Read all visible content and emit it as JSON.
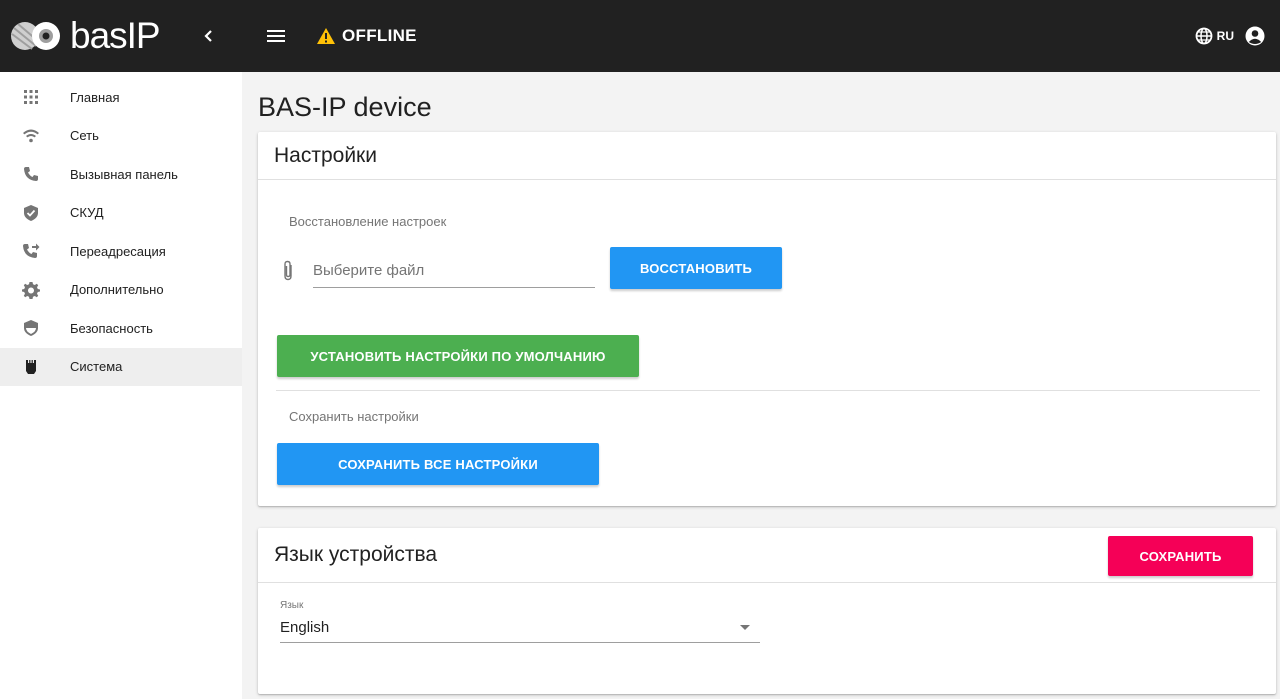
{
  "brand": {
    "name": "basIP"
  },
  "sidebar": {
    "items": [
      {
        "label": "Главная",
        "icon": "apps-grid-icon",
        "active": false
      },
      {
        "label": "Сеть",
        "icon": "wifi-icon",
        "active": false
      },
      {
        "label": "Вызывная панель",
        "icon": "phone-icon",
        "active": false
      },
      {
        "label": "СКУД",
        "icon": "shield-check-icon",
        "active": false
      },
      {
        "label": "Переадресация",
        "icon": "phone-forward-icon",
        "active": false
      },
      {
        "label": "Дополнительно",
        "icon": "gear-icon",
        "active": false
      },
      {
        "label": "Безопасность",
        "icon": "security-shield-icon",
        "active": false
      },
      {
        "label": "Система",
        "icon": "memory-card-icon",
        "active": true
      }
    ]
  },
  "topbar": {
    "status": "OFFLINE",
    "status_color": "#ffc107",
    "language": "RU"
  },
  "page": {
    "title": "BAS-IP device"
  },
  "settings_card": {
    "title": "Настройки",
    "restore_label": "Восстановление настроек",
    "file_placeholder": "Выберите файл",
    "restore_button": "ВОССТАНОВИТЬ",
    "defaults_button": "УСТАНОВИТЬ НАСТРОЙКИ ПО УМОЛЧАНИЮ",
    "save_label": "Сохранить настройки",
    "save_all_button": "СОХРАНИТЬ ВСЕ НАСТРОЙКИ"
  },
  "language_card": {
    "title": "Язык устройства",
    "save_button": "СОХРАНИТЬ",
    "field_label": "Язык",
    "selected": "English"
  },
  "colors": {
    "bar": "#212121",
    "blue": "#2196f3",
    "green": "#4caf50",
    "pink": "#f50057"
  }
}
